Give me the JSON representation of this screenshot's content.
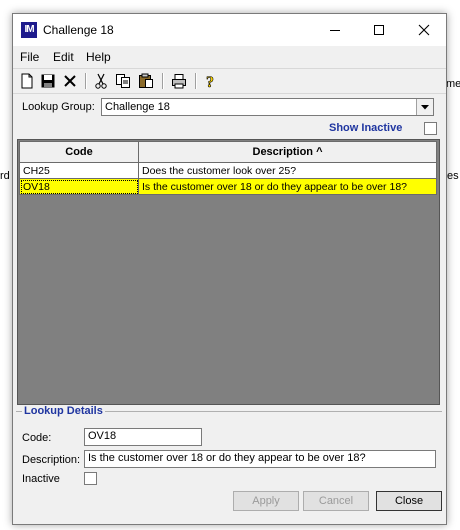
{
  "background": {
    "frag_mes": "mes",
    "frag_rd": "rd",
    "frag_es": "es"
  },
  "window": {
    "title": "Challenge 18",
    "app_icon_text": "IM"
  },
  "menu": [
    "File",
    "Edit",
    "Help"
  ],
  "lookup_group": {
    "label": "Lookup Group:",
    "value": "Challenge 18"
  },
  "show_inactive_label": "Show Inactive",
  "grid": {
    "columns": [
      "Code",
      "Description ^"
    ],
    "rows": [
      {
        "code": "CH25",
        "description": "Does the customer look over 25?"
      },
      {
        "code": "OV18",
        "description": "Is the customer over 18 or do they appear to be over 18?"
      }
    ],
    "selected_row": 1
  },
  "details": {
    "title": "Lookup Details",
    "code_label": "Code:",
    "code_value": "OV18",
    "description_label": "Description:",
    "description_value": "Is the customer over 18 or do they appear to be over 18?",
    "inactive_label": "Inactive"
  },
  "buttons": {
    "apply": "Apply",
    "cancel": "Cancel",
    "close": "Close"
  },
  "colors": {
    "selection": "#ffff00",
    "section_header": "#1f35a0",
    "grid_background": "#808080",
    "app_icon": "#1d1a8c"
  }
}
